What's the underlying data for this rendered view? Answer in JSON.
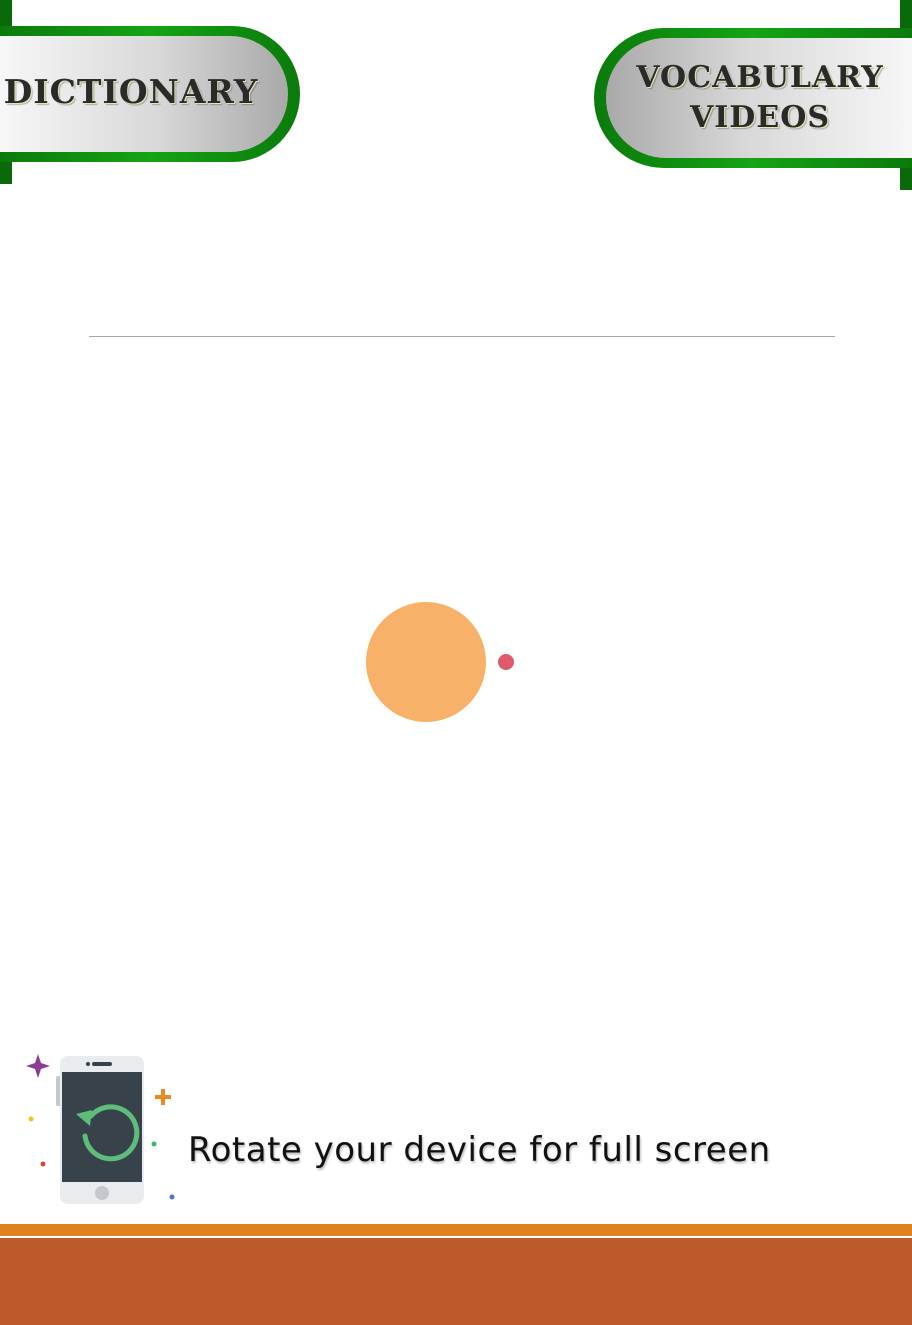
{
  "header": {
    "dictionary_label": "DICTIONARY",
    "videos_label_line1": "VOCABULARY",
    "videos_label_line2": "VIDEOS"
  },
  "rotate_hint": {
    "text": "Rotate your device for full screen",
    "icon": "rotate-phone-icon"
  },
  "colors": {
    "banner_green": "#0a8a0a",
    "banner_silver": "#c9c9c9",
    "loader_ball": "#f7b168",
    "loader_dot": "#e05a6a",
    "footer_stripe": "#e0801e",
    "footer_bar": "#bd5a2c"
  }
}
